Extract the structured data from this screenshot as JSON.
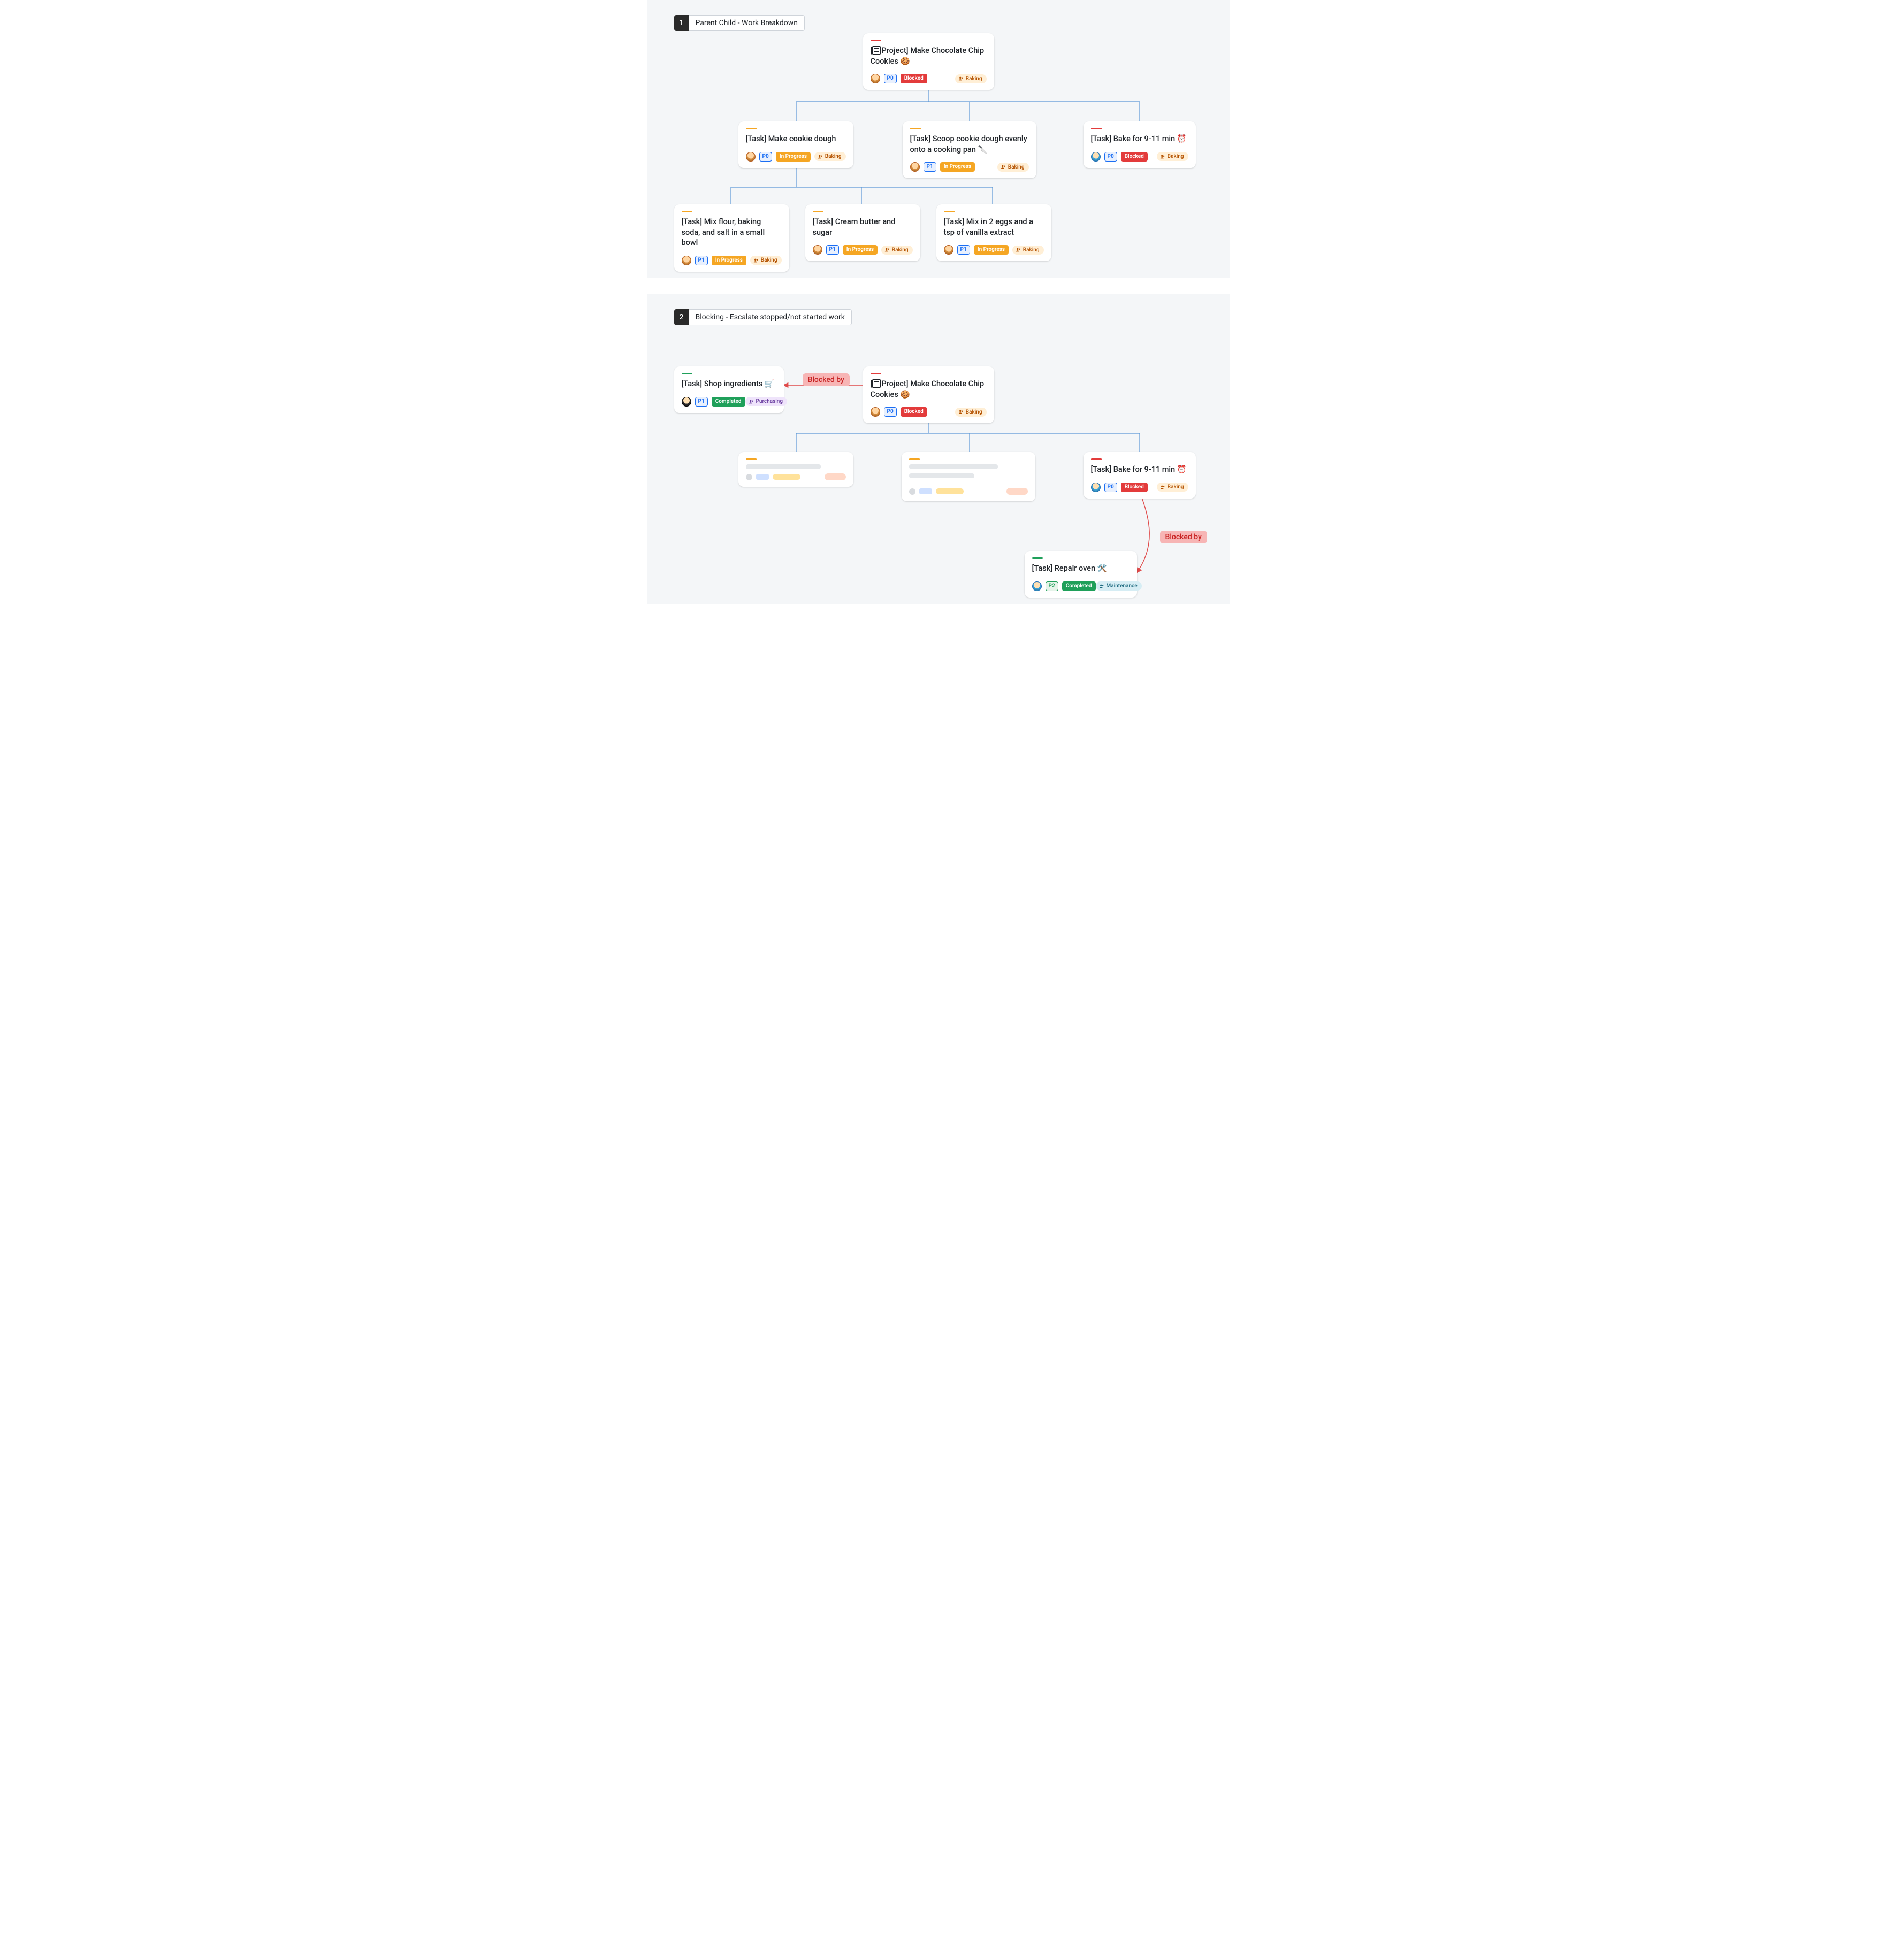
{
  "section1": {
    "number": "1",
    "label": "Parent Child - Work Breakdown",
    "cards": {
      "root": {
        "title_prefix": "[",
        "title_kind": "Project",
        "title_suffix": "] Make Chocolate Chip Cookies 🍪",
        "priority": "P0",
        "status": "Blocked",
        "status_class": "blocked",
        "tag": "Baking",
        "tag_class": "baking",
        "bar": "red",
        "avatar": "a1"
      },
      "c1": {
        "title": "[Task] Make cookie dough",
        "priority": "P0",
        "status": "In Progress",
        "status_class": "inprogress",
        "tag": "Baking",
        "tag_class": "baking",
        "bar": "orange",
        "avatar": "a1"
      },
      "c2": {
        "title": "[Task] Scoop cookie dough evenly onto a cooking pan 🔪",
        "priority": "P1",
        "status": "In Progress",
        "status_class": "inprogress",
        "tag": "Baking",
        "tag_class": "baking",
        "bar": "orange",
        "avatar": "a1"
      },
      "c3": {
        "title": "[Task] Bake for 9-11 min ⏰",
        "priority": "P0",
        "status": "Blocked",
        "status_class": "blocked",
        "tag": "Baking",
        "tag_class": "baking",
        "bar": "red",
        "avatar": "a2"
      },
      "g1": {
        "title": "[Task] Mix flour, baking soda, and salt in a small bowl",
        "priority": "P1",
        "status": "In Progress",
        "status_class": "inprogress",
        "tag": "Baking",
        "tag_class": "baking",
        "bar": "orange",
        "avatar": "a1"
      },
      "g2": {
        "title": "[Task] Cream butter and sugar",
        "priority": "P1",
        "status": "In Progress",
        "status_class": "inprogress",
        "tag": "Baking",
        "tag_class": "baking",
        "bar": "orange",
        "avatar": "a1"
      },
      "g3": {
        "title": "[Task] Mix in 2 eggs and a tsp of vanilla extract",
        "priority": "P1",
        "status": "In Progress",
        "status_class": "inprogress",
        "tag": "Baking",
        "tag_class": "baking",
        "bar": "orange",
        "avatar": "a1"
      }
    }
  },
  "section2": {
    "number": "2",
    "label": "Blocking - Escalate stopped/not started work",
    "blocked_by_label": "Blocked by",
    "cards": {
      "shop": {
        "title": "[Task] Shop ingredients 🛒",
        "priority": "P1",
        "status": "Completed",
        "status_class": "completed",
        "tag": "Purchasing",
        "tag_class": "purchasing",
        "bar": "green",
        "avatar": "a3"
      },
      "root": {
        "title_prefix": "[",
        "title_kind": "Project",
        "title_suffix": "] Make Chocolate Chip Cookies 🍪",
        "priority": "P0",
        "status": "Blocked",
        "status_class": "blocked",
        "tag": "Baking",
        "tag_class": "baking",
        "bar": "red",
        "avatar": "a1"
      },
      "bake": {
        "title": "[Task] Bake for 9-11 min ⏰",
        "priority": "P0",
        "status": "Blocked",
        "status_class": "blocked",
        "tag": "Baking",
        "tag_class": "baking",
        "bar": "red",
        "avatar": "a2"
      },
      "repair": {
        "title": "[Task] Repair oven 🛠️",
        "priority": "P2",
        "status": "Completed",
        "status_class": "completed",
        "tag": "Maintenance",
        "tag_class": "maintenance",
        "bar": "green",
        "avatar": "a2"
      }
    }
  }
}
